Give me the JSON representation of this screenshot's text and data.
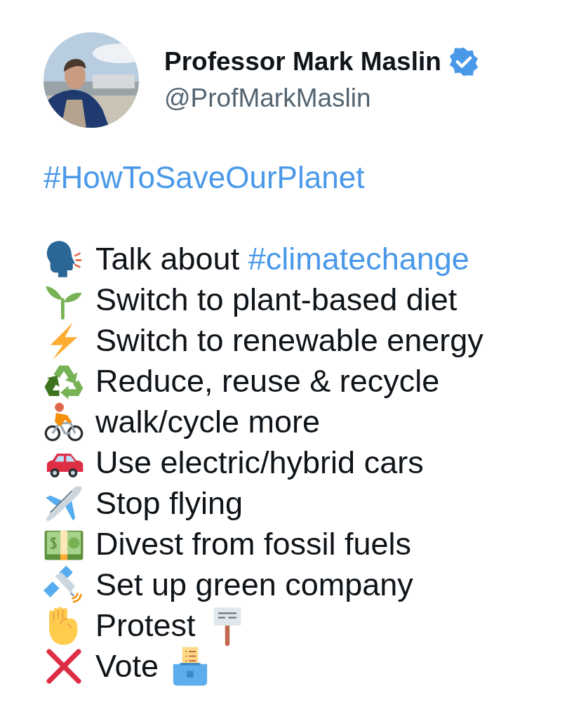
{
  "author": {
    "name": "Professor Mark Maslin",
    "verified": true,
    "handle": "@ProfMarkMaslin"
  },
  "hashtag": "#HowToSaveOurPlanet",
  "items": [
    {
      "text": "Talk about ",
      "hashtag": "#climatechange"
    },
    {
      "text": "Switch to plant-based diet"
    },
    {
      "text": "Switch to renewable energy"
    },
    {
      "text": "Reduce, reuse & recycle"
    },
    {
      "text": "walk/cycle more"
    },
    {
      "text": "Use electric/hybrid cars"
    },
    {
      "text": "Stop flying"
    },
    {
      "text": "Divest from fossil fuels"
    },
    {
      "text": "Set up green company"
    },
    {
      "text": "Protest"
    },
    {
      "text": "Vote"
    }
  ]
}
